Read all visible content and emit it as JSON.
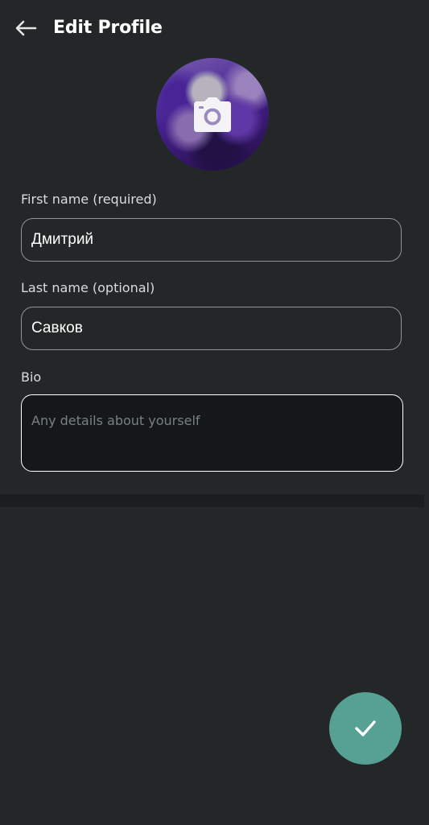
{
  "header": {
    "title": "Edit Profile",
    "back_icon": "arrow-left-icon"
  },
  "avatar": {
    "icon": "camera-icon"
  },
  "form": {
    "first_name": {
      "label": "First name (required)",
      "value": "Дмитрий"
    },
    "last_name": {
      "label": "Last name (optional)",
      "value": "Савков"
    },
    "bio": {
      "label": "Bio",
      "value": "",
      "placeholder": "Any details about yourself"
    }
  },
  "fab": {
    "icon": "check-icon",
    "color": "#56a094"
  },
  "colors": {
    "background": "#232727",
    "divider": "#1b1e1e",
    "field_border": "#8f9595",
    "focused_border": "#ffffff",
    "accent": "#56a094"
  }
}
